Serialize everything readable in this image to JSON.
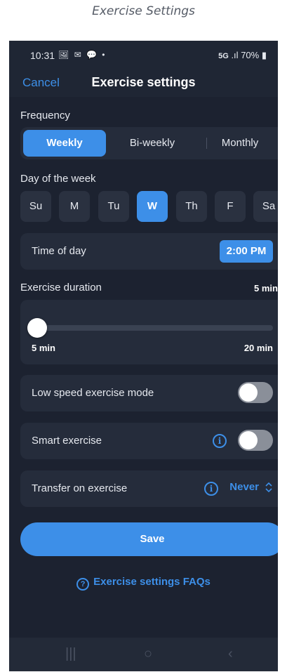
{
  "caption": "Exercise Settings",
  "status_bar": {
    "time": "10:31",
    "notification_icons": "🖼 ✉ 💬 •",
    "network": "5G",
    "signal": ".ıl",
    "battery": "70%"
  },
  "nav": {
    "cancel_label": "Cancel",
    "title": "Exercise settings"
  },
  "frequency": {
    "label": "Frequency",
    "options": [
      "Weekly",
      "Bi-weekly",
      "Monthly"
    ],
    "selected": "Weekly"
  },
  "day_of_week": {
    "label": "Day of the week",
    "days": [
      "Su",
      "M",
      "Tu",
      "W",
      "Th",
      "F",
      "Sa"
    ],
    "selected": "W"
  },
  "time_of_day": {
    "label": "Time of day",
    "value": "2:00 PM"
  },
  "duration": {
    "label": "Exercise duration",
    "current": "5 min",
    "current_value": 5,
    "min_label": "5 min",
    "max_label": "20 min",
    "min_value": 5,
    "max_value": 20
  },
  "low_speed": {
    "label": "Low speed exercise mode",
    "enabled": false
  },
  "smart_exercise": {
    "label": "Smart exercise",
    "enabled": false
  },
  "transfer": {
    "label": "Transfer on exercise",
    "value": "Never"
  },
  "save_label": "Save",
  "faq_label": "Exercise settings FAQs",
  "colors": {
    "accent": "#3d8fe8",
    "background": "#1c2230",
    "card": "#252c3b"
  }
}
